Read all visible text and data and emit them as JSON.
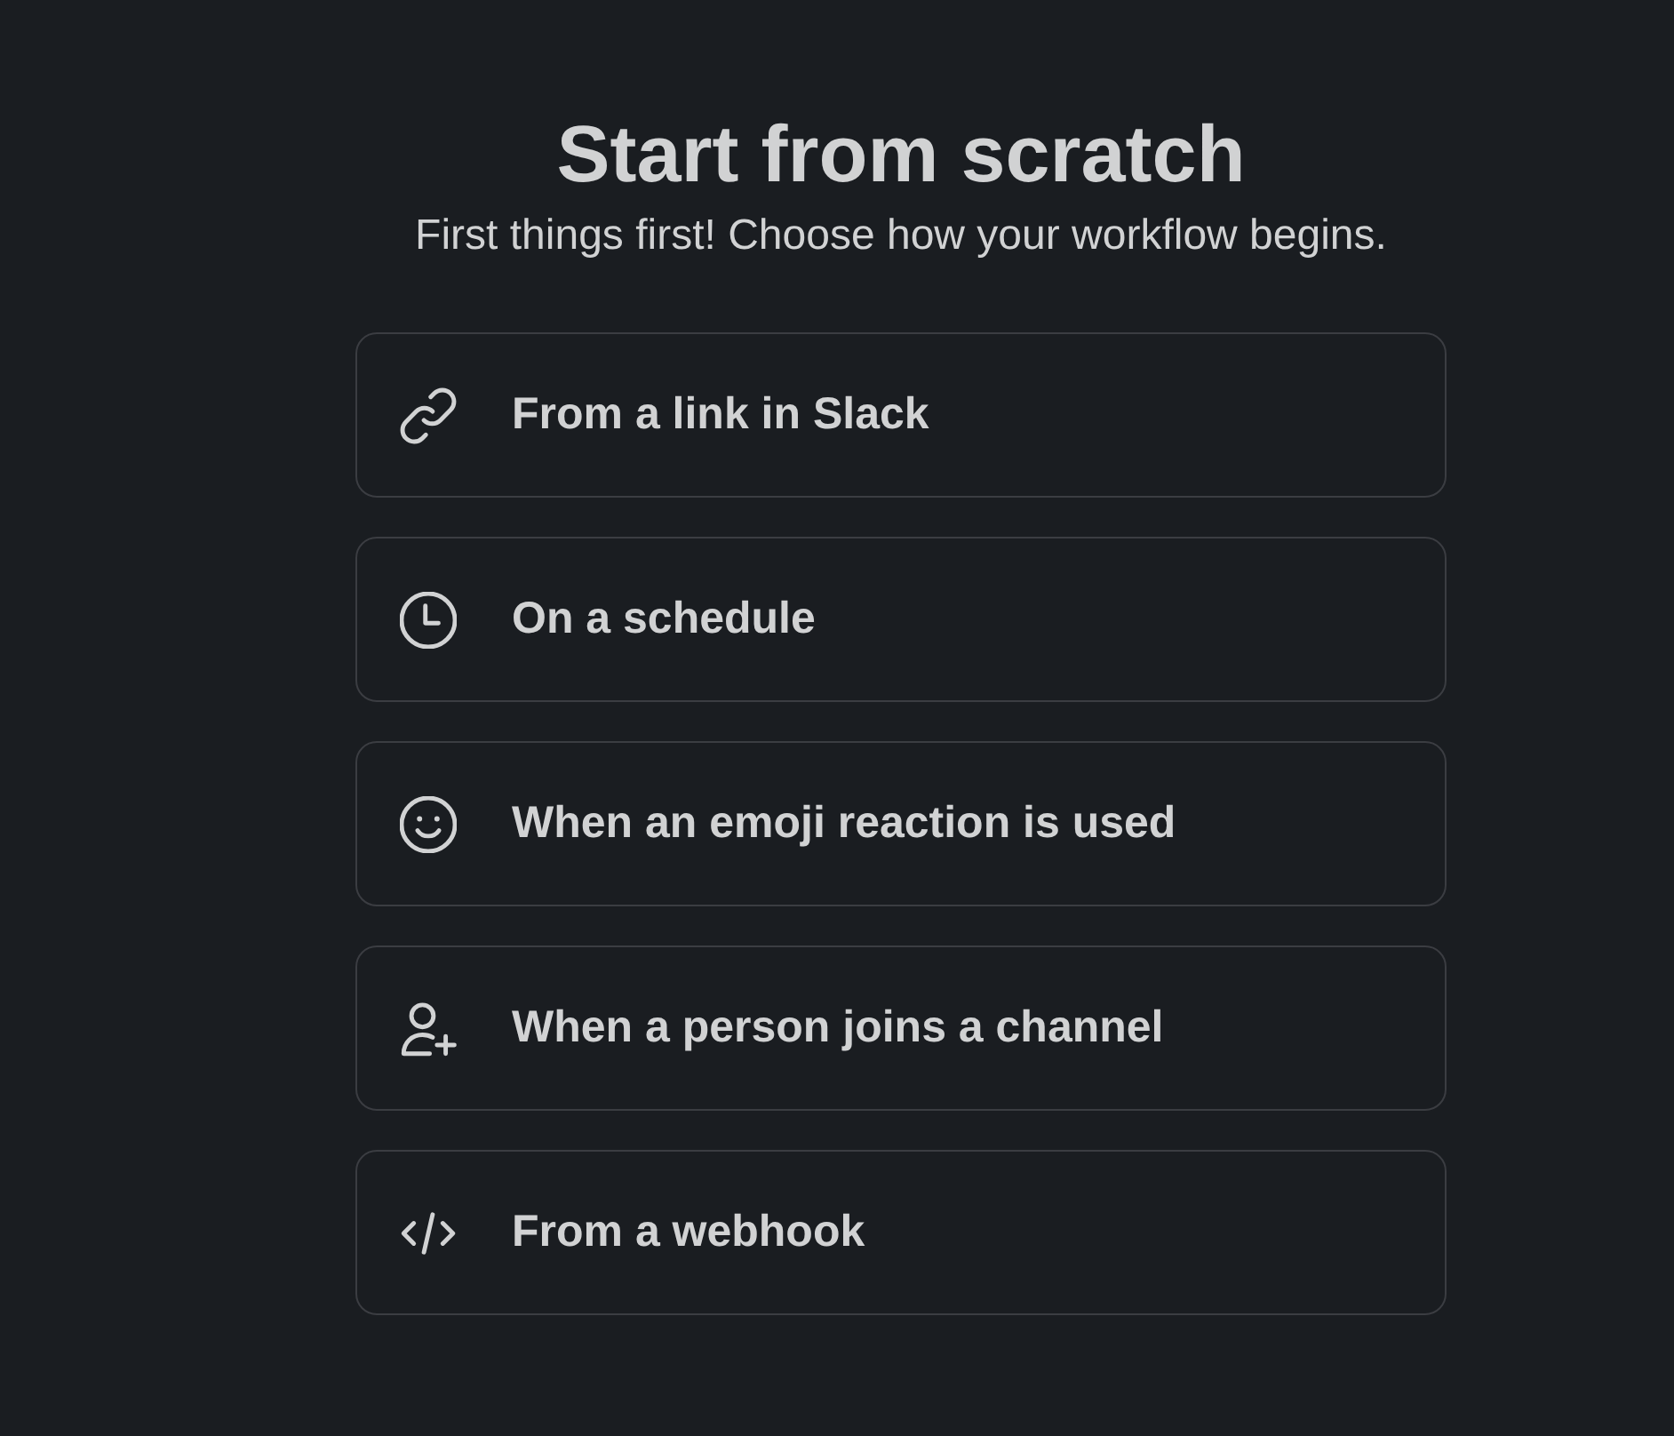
{
  "header": {
    "title": "Start from scratch",
    "subtitle": "First things first! Choose how your workflow begins."
  },
  "options": [
    {
      "kind": "link",
      "label": "From a link in Slack"
    },
    {
      "kind": "clock",
      "label": "On a schedule"
    },
    {
      "kind": "emoji",
      "label": "When an emoji reaction is used"
    },
    {
      "kind": "person_add",
      "label": "When a person joins a channel"
    },
    {
      "kind": "code",
      "label": "From a webhook"
    }
  ]
}
